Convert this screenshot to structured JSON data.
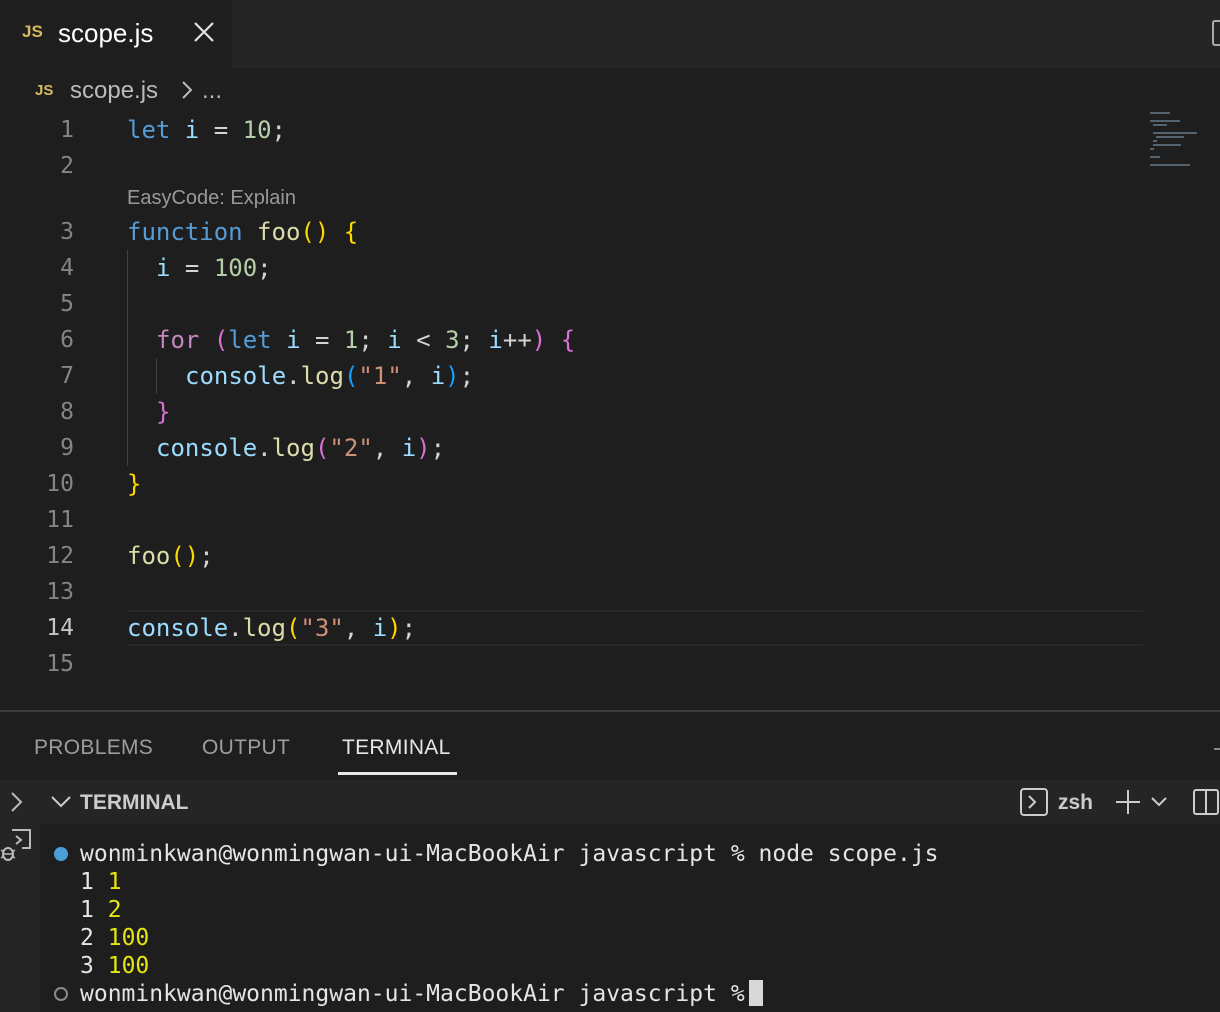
{
  "tab": {
    "icon_label": "JS",
    "filename": "scope.js"
  },
  "breadcrumb": {
    "icon_label": "JS",
    "file": "scope.js",
    "more": "..."
  },
  "codelens": "EasyCode: Explain",
  "editor": {
    "active_line": 14,
    "line_numbers": [
      "1",
      "2",
      "3",
      "4",
      "5",
      "6",
      "7",
      "8",
      "9",
      "10",
      "11",
      "12",
      "13",
      "14",
      "15"
    ]
  },
  "panel": {
    "tabs": [
      "PROBLEMS",
      "OUTPUT",
      "TERMINAL"
    ],
    "active_tab": "TERMINAL",
    "terminal_title": "TERMINAL",
    "shell": "zsh"
  },
  "terminal": {
    "prompt": "wonminkwan@wonmingwan-ui-MacBookAir javascript % ",
    "command": "node scope.js",
    "output": [
      {
        "label": "1",
        "value": "1"
      },
      {
        "label": "1",
        "value": "2"
      },
      {
        "label": "2",
        "value": "100"
      },
      {
        "label": "3",
        "value": "100"
      }
    ],
    "prompt2": "wonminkwan@wonmingwan-ui-MacBookAir javascript %"
  },
  "code": {
    "l1": {
      "a": "let",
      "b": " i ",
      "c": "= ",
      "d": "10",
      "e": ";"
    },
    "l3": {
      "a": "function",
      "b": " ",
      "c": "foo",
      "d": "()",
      "e": " ",
      "f": "{"
    },
    "l4": {
      "a": "i",
      "b": " = ",
      "c": "100",
      "d": ";"
    },
    "l6": {
      "a": "for",
      "b": " ",
      "c": "(",
      "d": "let",
      "e": " i ",
      "f": "= ",
      "g": "1",
      "h": "; ",
      "i": "i",
      "j": " < ",
      "k": "3",
      "l": "; ",
      "m": "i",
      "n": "++",
      "o": ")",
      "p": " ",
      "q": "{"
    },
    "l7": {
      "a": "console",
      "b": ".",
      "c": "log",
      "d": "(",
      "e": "\"1\"",
      "f": ", ",
      "g": "i",
      "h": ")",
      "i": ";"
    },
    "l8": {
      "a": "}"
    },
    "l9": {
      "a": "console",
      "b": ".",
      "c": "log",
      "d": "(",
      "e": "\"2\"",
      "f": ", ",
      "g": "i",
      "h": ")",
      "i": ";"
    },
    "l10": {
      "a": "}"
    },
    "l12": {
      "a": "foo",
      "b": "()",
      "c": ";"
    },
    "l14": {
      "a": "console",
      "b": ".",
      "c": "log",
      "d": "(",
      "e": "\"3\"",
      "f": ", ",
      "g": "i",
      "h": ")",
      "i": ";"
    }
  },
  "colors": {
    "keyword": "#569cd6",
    "control": "#c586c0",
    "variable": "#9cdcfe",
    "number": "#b5cea8",
    "function": "#dcdcaa",
    "string": "#ce9178",
    "bracket_1": "#ffd700",
    "bracket_2": "#da70d6",
    "bracket_3": "#179fff",
    "js_icon": "#d7ba5f",
    "terminal_yellow": "#e5e510",
    "status_dot": "#4c9fd6"
  },
  "icons": [
    "close-icon",
    "chevron-right-icon",
    "terminal-icon",
    "plus-icon",
    "chevron-down-icon",
    "split-terminal-icon",
    "debug-icon"
  ]
}
